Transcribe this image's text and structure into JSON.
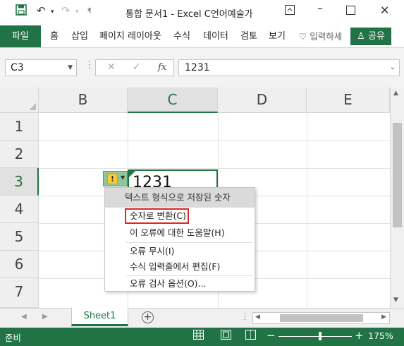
{
  "titlebar": {
    "title": "통합 문서1  -  Excel   C언어예술가",
    "save_icon": "save-icon",
    "undo_icon": "undo-icon",
    "redo_icon": "redo-icon"
  },
  "ribbon": {
    "file_label": "파일",
    "tabs": [
      "홈",
      "삽입",
      "페이지 레이아웃",
      "수식",
      "데이터",
      "검토",
      "보기"
    ],
    "tell_me": "입력하세",
    "share_label": "공유"
  },
  "formula_bar": {
    "name_box": "C3",
    "fx_label": "fx",
    "value": "1231"
  },
  "grid": {
    "columns": [
      "B",
      "C",
      "D",
      "E"
    ],
    "active_column": "C",
    "rows": [
      "1",
      "2",
      "3",
      "4",
      "5",
      "6",
      "7"
    ],
    "active_row": "3",
    "active_cell_value": "1231"
  },
  "error_menu": {
    "header": "텍스트 형식으로 저장된 숫자",
    "items": [
      "숫자로 변환(C)",
      "이 오류에 대한 도움말(H)",
      "오류 무시(I)",
      "수식 입력줄에서 편집(F)",
      "오류 검사 옵션(O)..."
    ]
  },
  "sheets": {
    "tabs": [
      "Sheet1"
    ],
    "add_label": "+"
  },
  "status": {
    "ready": "준비",
    "zoom": "175%",
    "zoom_out": "−",
    "zoom_in": "+"
  },
  "colors": {
    "accent": "#217346",
    "highlight_box": "#d62828"
  }
}
